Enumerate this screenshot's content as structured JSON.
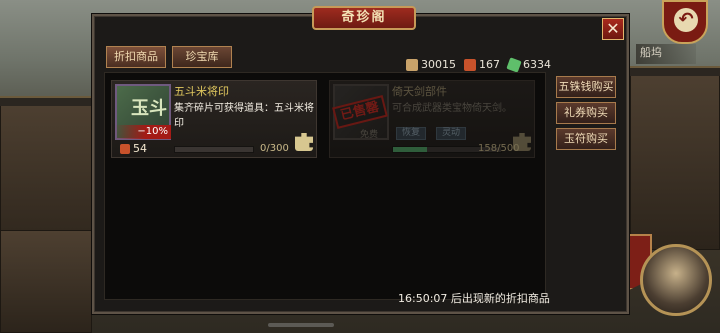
{
  "window": {
    "title": "奇珍阁"
  },
  "close": {
    "symbol": "✕"
  },
  "tabs": [
    {
      "label": "折扣商品",
      "active": true
    },
    {
      "label": "珍宝库",
      "active": false
    }
  ],
  "currencies": [
    {
      "icon": "scroll-coin-icon",
      "value": "30015",
      "color": "#c9a36a"
    },
    {
      "icon": "ticket-icon",
      "value": "167",
      "color": "#c8522b"
    },
    {
      "icon": "jade-icon",
      "value": "6334",
      "color": "#5fbf6b"
    }
  ],
  "cards": [
    {
      "name": "五斗米将印",
      "desc": "集齐碎片可获得道具：五斗米将印",
      "discount": "−10%",
      "price": "54",
      "progress_text": "0/300",
      "progress_fraction": 0,
      "glyph": "玉斗",
      "dim": false
    },
    {
      "name": "倚天剑部件",
      "desc": "可合成武器类宝物倚天剑。",
      "stamp": "已售罄",
      "free_label": "免费",
      "chips": [
        "恢复",
        "灵动"
      ],
      "progress_text": "158/500",
      "progress_fraction": 0.316,
      "dim": true
    }
  ],
  "side_buttons": [
    {
      "label": "五铢钱购买"
    },
    {
      "label": "礼券购买"
    },
    {
      "label": "玉符购买"
    }
  ],
  "footer": {
    "text": "16:50:07  后出现新的折扣商品"
  },
  "background": {
    "tab_label": "船坞"
  }
}
